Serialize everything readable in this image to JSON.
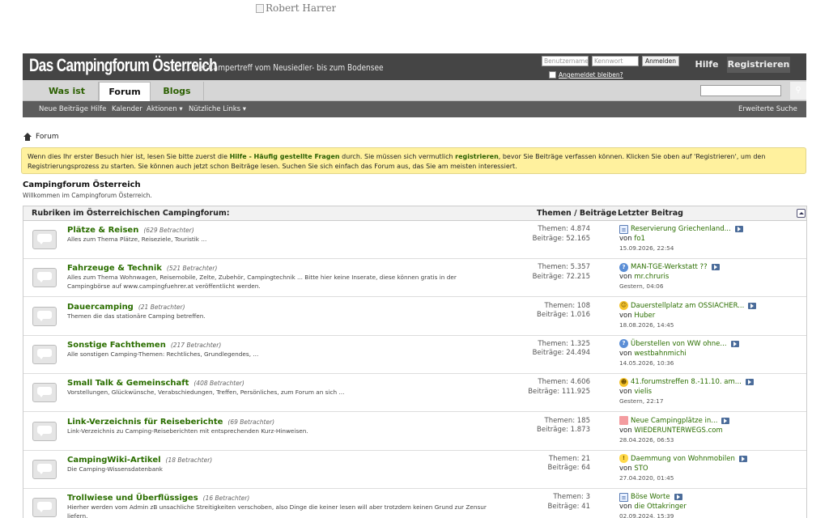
{
  "banner": {
    "alt_text": "Robert Harrer"
  },
  "header": {
    "logo": "Das Campingforum Österreich",
    "tagline": "... der Campertreff vom Neusiedler- bis zum Bodensee",
    "username_placeholder": "Benutzername",
    "password_placeholder": "Kennwort",
    "login_button": "Anmelden",
    "remember_label": "Angemeldet bleiben?",
    "help_link": "Hilfe",
    "register_link": "Registrieren"
  },
  "nav": {
    "tabs": [
      {
        "label": "Was ist neu?"
      },
      {
        "label": "Forum",
        "active": true
      },
      {
        "label": "Blogs"
      }
    ],
    "search_button_icon": "search-icon"
  },
  "subnav": {
    "links": [
      "Neue Beiträge",
      "Hilfe",
      "Kalender",
      "Aktionen ▾",
      "Nützliche Links ▾"
    ],
    "advanced_search": "Erweiterte Suche"
  },
  "breadcrumb": {
    "label": "Forum"
  },
  "notice": {
    "part1": "Wenn dies Ihr erster Besuch hier ist, lesen Sie bitte zuerst die ",
    "faq_link": "Hilfe - Häufig gestellte Fragen",
    "part2": " durch. Sie müssen sich vermutlich ",
    "register_link": "registrieren",
    "part3": ", bevor Sie Beiträge verfassen können. Klicken Sie oben auf 'Registrieren', um den Registrierungsprozess zu starten. Sie können auch jetzt schon Beiträge lesen. Suchen Sie sich einfach das Forum aus, das Sie am meisten interessiert."
  },
  "section": {
    "title": "Campingforum Österreich",
    "subtitle": "Willkommen im Campingforum Österreich."
  },
  "table": {
    "col_rubriken": "Rubriken im Österreichischen Campingforum:",
    "col_stats": "Themen / Beiträge",
    "col_last": "Letzter Beitrag",
    "rows": [
      {
        "name": "Plätze & Reisen",
        "viewers": "(629 Betrachter)",
        "desc": "Alles zum Thema Plätze, Reiseziele, Touristik ...",
        "topics": "Themen: 4.874",
        "posts": "Beiträge: 52.165",
        "last_title": "Reservierung Griechenland...",
        "last_icon": "doc",
        "last_by_prefix": "von ",
        "last_user": "fo1",
        "last_date": "15.09.2026, 22:54"
      },
      {
        "name": "Fahrzeuge & Technik",
        "viewers": "(521 Betrachter)",
        "desc": "Alles zum Thema Wohnwagen, Reisemobile, Zelte, Zubehör, Campingtechnik ... Bitte hier keine Inserate, diese können gratis in der Campingbörse auf www.campingfuehrer.at veröffentlicht werden.",
        "topics": "Themen: 5.357",
        "posts": "Beiträge: 72.215",
        "last_title": "MAN-TGE-Werkstatt ??",
        "last_icon": "q",
        "last_by_prefix": "von ",
        "last_user": "mr.chruris",
        "last_date": "Gestern, 04:06"
      },
      {
        "name": "Dauercamping",
        "viewers": "(21 Betrachter)",
        "desc": "Themen die das stationäre Camping betreffen.",
        "topics": "Themen: 108",
        "posts": "Beiträge: 1.016",
        "last_title": "Dauerstellplatz am OSSIACHER...",
        "last_icon": "smile",
        "last_by_prefix": "von ",
        "last_user": "Huber",
        "last_date": "18.08.2026, 14:45"
      },
      {
        "name": "Sonstige Fachthemen",
        "viewers": "(217 Betrachter)",
        "desc": "Alle sonstigen Camping-Themen: Rechtliches, Grundlegendes, ...",
        "topics": "Themen: 1.325",
        "posts": "Beiträge: 24.494",
        "last_title": "Überstellen von WW ohne...",
        "last_icon": "q",
        "last_by_prefix": "von ",
        "last_user": "westbahnmichi",
        "last_date": "14.05.2026, 10:36"
      },
      {
        "name": "Small Talk & Gemeinschaft",
        "viewers": "(408 Betrachter)",
        "desc": "Vorstellungen, Glückwünsche, Verabschiedungen, Treffen, Persönliches, zum Forum an sich ...",
        "topics": "Themen: 4.606",
        "posts": "Beiträge: 111.925",
        "last_title": "41.forumstreffen 8.-11.10. am...",
        "last_icon": "wink",
        "last_by_prefix": "von ",
        "last_user": "vielis",
        "last_date": "Gestern, 22:17"
      },
      {
        "name": "Link-Verzeichnis für Reiseberichte",
        "viewers": "(69 Betrachter)",
        "desc": "Link-Verzeichnis zu Camping-Reiseberichten mit entsprechenden Kurz-Hinweisen.",
        "topics": "Themen: 185",
        "posts": "Beiträge: 1.873",
        "last_title": "Neue Campingplätze in...",
        "last_icon": "flag",
        "last_by_prefix": "von ",
        "last_user": "WIEDERUNTERWEGS.com",
        "last_date": "28.04.2026, 06:53"
      },
      {
        "name": "CampingWiki-Artikel",
        "viewers": "(18 Betrachter)",
        "desc": "Die Camping-Wissensdatenbank",
        "topics": "Themen: 21",
        "posts": "Beiträge: 64",
        "last_title": "Daemmung von Wohnmobilen",
        "last_icon": "bulb",
        "last_by_prefix": "von ",
        "last_user": "STO",
        "last_date": "27.04.2020, 01:45"
      },
      {
        "name": "Trollwiese und Überflüssiges",
        "viewers": "(16 Betrachter)",
        "desc": "Hierher werden vom Admin zB unsachliche Streitigkeiten verschoben, also Dinge die keiner lesen will aber trotzdem keinen Grund zur Zensur liefern.",
        "topics": "Themen: 3",
        "posts": "Beiträge: 41",
        "last_title": "Böse Worte",
        "last_icon": "doc",
        "last_by_prefix": "von ",
        "last_user": "die Ottakringer",
        "last_date": "02.09.2024, 15:39"
      }
    ]
  }
}
